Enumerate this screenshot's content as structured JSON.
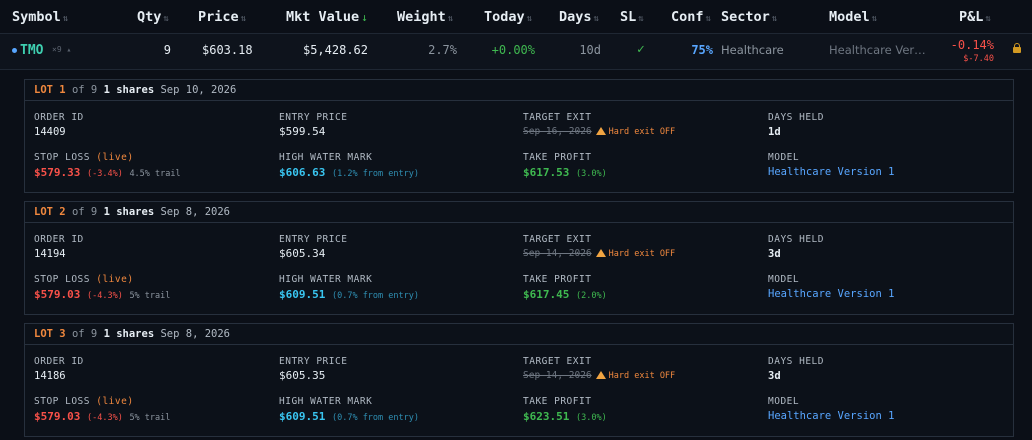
{
  "header": {
    "symbol": "Symbol",
    "qty": "Qty",
    "price": "Price",
    "mkt_value": "Mkt Value",
    "weight": "Weight",
    "today": "Today",
    "days": "Days",
    "sl": "SL",
    "conf": "Conf",
    "sector": "Sector",
    "model": "Model",
    "pl": "P&L",
    "sort_glyph": "⇅",
    "active_sort_glyph": "↓"
  },
  "position": {
    "symbol": "TMO",
    "symbol_sub": "×9 ▴",
    "qty": "9",
    "price": "$603.18",
    "mkt_value": "$5,428.62",
    "weight": "2.7%",
    "today": "+0.00%",
    "days": "10d",
    "sl": "✓",
    "conf": "75%",
    "sector": "Healthcare",
    "model": "Healthcare Ver…",
    "pl_pct": "-0.14%",
    "pl_abs": "$-7.40"
  },
  "field_labels": {
    "order_id": "ORDER ID",
    "entry_price": "ENTRY PRICE",
    "target_exit": "TARGET EXIT",
    "days_held": "DAYS HELD",
    "stop_loss": "STOP LOSS",
    "high_water_mark": "HIGH WATER MARK",
    "take_profit": "TAKE PROFIT",
    "model": "MODEL",
    "live": "(live)",
    "hard_exit": "Hard exit OFF"
  },
  "lots": [
    {
      "label": "LOT 1",
      "of": "of 9",
      "shares": "1 shares",
      "date": "Sep 10, 2026",
      "order_id": "14409",
      "entry_price": "$599.54",
      "target_exit": "Sep 16, 2026",
      "days_held": "1d",
      "stop_loss": "$579.33",
      "stop_pct": "(-3.4%)",
      "trail": "4.5% trail",
      "hwm": "$606.63",
      "hwm_note": "(1.2% from entry)",
      "take_profit": "$617.53",
      "tp_pct": "(3.0%)",
      "model": "Healthcare Version 1"
    },
    {
      "label": "LOT 2",
      "of": "of 9",
      "shares": "1 shares",
      "date": "Sep 8, 2026",
      "order_id": "14194",
      "entry_price": "$605.34",
      "target_exit": "Sep 14, 2026",
      "days_held": "3d",
      "stop_loss": "$579.03",
      "stop_pct": "(-4.3%)",
      "trail": "5% trail",
      "hwm": "$609.51",
      "hwm_note": "(0.7% from entry)",
      "take_profit": "$617.45",
      "tp_pct": "(2.0%)",
      "model": "Healthcare Version 1"
    },
    {
      "label": "LOT 3",
      "of": "of 9",
      "shares": "1 shares",
      "date": "Sep 8, 2026",
      "order_id": "14186",
      "entry_price": "$605.35",
      "target_exit": "Sep 14, 2026",
      "days_held": "3d",
      "stop_loss": "$579.03",
      "stop_pct": "(-4.3%)",
      "trail": "5% trail",
      "hwm": "$609.51",
      "hwm_note": "(0.7% from entry)",
      "take_profit": "$623.51",
      "tp_pct": "(3.0%)",
      "model": "Healthcare Version 1"
    }
  ]
}
